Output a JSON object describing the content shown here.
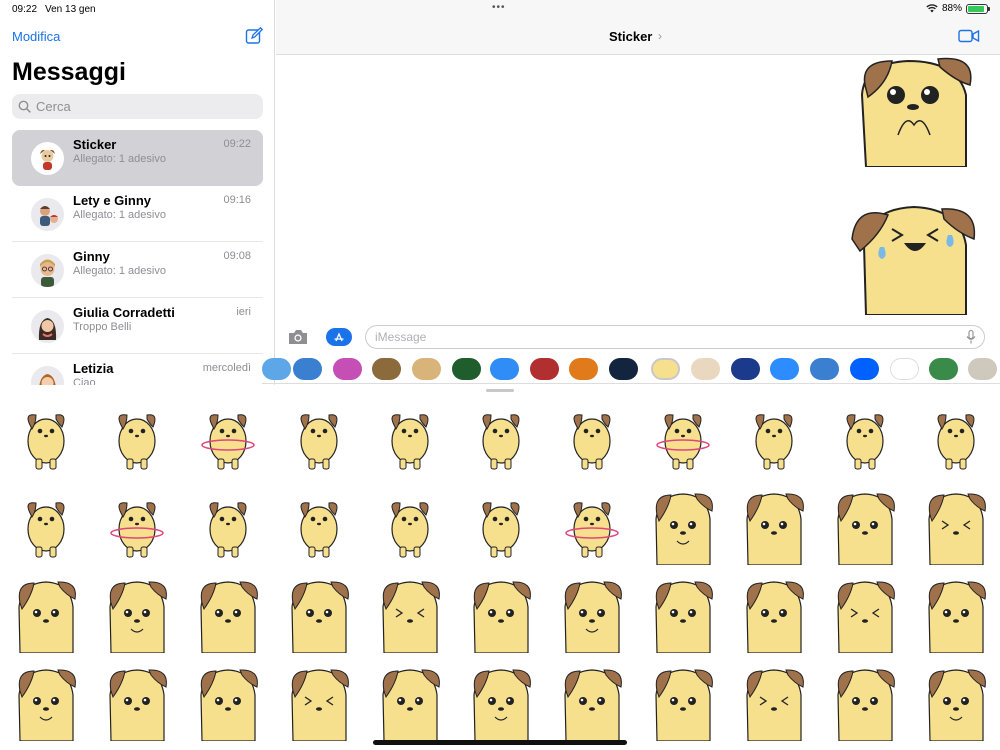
{
  "status": {
    "time": "09:22",
    "date": "Ven 13 gen",
    "battery_text": "88%",
    "battery_level": 0.88,
    "battery_color": "#34c759"
  },
  "sidebar": {
    "edit_label": "Modifica",
    "title": "Messaggi",
    "search_placeholder": "Cerca",
    "conversations": [
      {
        "name": "Sticker",
        "time": "09:22",
        "preview": "Allegato: 1 adesivo",
        "selected": true
      },
      {
        "name": "Lety e Ginny",
        "time": "09:16",
        "preview": "Allegato: 1 adesivo",
        "selected": false
      },
      {
        "name": "Ginny",
        "time": "09:08",
        "preview": "Allegato: 1 adesivo",
        "selected": false
      },
      {
        "name": "Giulia Corradetti",
        "time": "ieri",
        "preview": "Troppo Belli",
        "selected": false
      },
      {
        "name": "Letizia",
        "time": "mercoledì",
        "preview": "Ciao",
        "selected": false
      }
    ]
  },
  "chat": {
    "title": "Sticker",
    "input_placeholder": "iMessage"
  },
  "colors": {
    "accent": "#1a73e8",
    "dog_body": "#f6e08e",
    "dog_ear": "#a0724b"
  },
  "icons": [
    "compose-icon",
    "search-icon",
    "video-camera-icon",
    "camera-icon",
    "app-store-icon",
    "microphone-icon",
    "wifi-icon",
    "battery-icon"
  ]
}
